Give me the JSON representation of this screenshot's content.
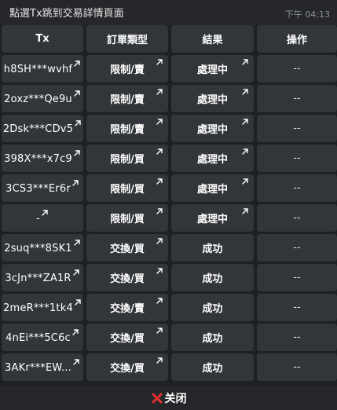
{
  "header": {
    "title": "點選Tx跳到交易詳情頁面",
    "time": "下午 04:13"
  },
  "table": {
    "columns": [
      "Tx",
      "訂單類型",
      "結果",
      "操作"
    ],
    "rows": [
      {
        "tx": "h8SH***wvhf",
        "type": "限制/賣",
        "result": "處理中",
        "action": "--"
      },
      {
        "tx": "2oxz***Qe9u",
        "type": "限制/賣",
        "result": "處理中",
        "action": "--"
      },
      {
        "tx": "2Dsk***CDv5",
        "type": "限制/賣",
        "result": "處理中",
        "action": "--"
      },
      {
        "tx": "398X***x7c9",
        "type": "限制/買",
        "result": "處理中",
        "action": "--"
      },
      {
        "tx": "3CS3***Er6r",
        "type": "限制/買",
        "result": "處理中",
        "action": "--"
      },
      {
        "tx": "-",
        "type": "限制/買",
        "result": "處理中",
        "action": "--"
      },
      {
        "tx": "2suq***8SK1",
        "type": "交換/買",
        "result": "成功",
        "action": "--"
      },
      {
        "tx": "3cJn***ZA1R",
        "type": "交換/買",
        "result": "成功",
        "action": "--"
      },
      {
        "tx": "2meR***1tk4",
        "type": "交換/賣",
        "result": "成功",
        "action": "--"
      },
      {
        "tx": "4nEi***5C6c",
        "type": "交換/買",
        "result": "成功",
        "action": "--"
      },
      {
        "tx": "3AKr***EW...",
        "type": "交換/買",
        "result": "成功",
        "action": "--"
      }
    ]
  },
  "footer": {
    "close_label": "关闭"
  },
  "colors": {
    "background": "#1e2023",
    "cell": "#323539",
    "close_icon": "#e8312e"
  },
  "icons": {
    "link": "external-arrow-icon",
    "close": "close-x-icon"
  }
}
